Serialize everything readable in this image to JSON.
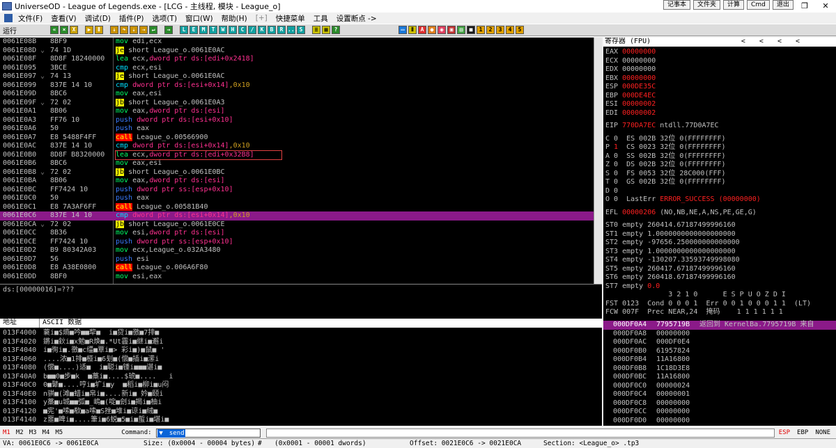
{
  "window": {
    "title": "UniverseOD - League of Legends.exe - [LCG - 主线程, 模块 - League_o]",
    "top_buttons": [
      "记事本",
      "文件夹",
      "计算",
      "Cmd",
      "退出"
    ]
  },
  "menu": [
    "文件(F)",
    "查看(V)",
    "调试(D)",
    "插件(P)",
    "选项(T)",
    "窗口(W)",
    "帮助(H)",
    "[+]",
    "快捷菜单",
    "工具",
    "设置断点 ->"
  ],
  "toolbar": {
    "status": "运行",
    "letters": [
      "L",
      "E",
      "M",
      "T",
      "W",
      "H",
      "C",
      "/",
      "K",
      "B",
      "R",
      "...",
      "S"
    ],
    "nums": [
      "1",
      "2",
      "3",
      "4",
      "5"
    ]
  },
  "colors": {
    "selection": "#8b1a89",
    "call_bg": "#ff0000",
    "jump_bg": "#ffff00"
  },
  "cpu": {
    "rows": [
      {
        "addr": "0061E08B",
        "tick": "",
        "hex": "8BF9",
        "m": "mov",
        "mc": "mov",
        "ops": [
          [
            "edi,ecx",
            "reg"
          ]
        ]
      },
      {
        "addr": "0061E08D",
        "tick": "⌄",
        "hex": "74 1D",
        "m": "je",
        "mc": "jmp",
        "ops": [
          [
            "short League_o.0061E0AC",
            "reg"
          ]
        ]
      },
      {
        "addr": "0061E08F",
        "tick": "",
        "hex": "8D8F 18240000",
        "m": "lea",
        "mc": "lea",
        "ops": [
          [
            "ecx,",
            "reg"
          ],
          [
            "dword ptr ds:[edi+0x2418]",
            "mem"
          ]
        ]
      },
      {
        "addr": "0061E095",
        "tick": "",
        "hex": "3BCE",
        "m": "cmp",
        "mc": "cmp",
        "ops": [
          [
            "ecx,esi",
            "reg"
          ]
        ]
      },
      {
        "addr": "0061E097",
        "tick": "⌄",
        "hex": "74 13",
        "m": "je",
        "mc": "jmp",
        "ops": [
          [
            "short League_o.0061E0AC",
            "reg"
          ]
        ]
      },
      {
        "addr": "0061E099",
        "tick": "",
        "hex": "837E 14 10",
        "m": "cmp",
        "mc": "cmp",
        "ops": [
          [
            "dword ptr ds:[esi+0x14]",
            "mem"
          ],
          [
            ",0x10",
            "imm"
          ]
        ]
      },
      {
        "addr": "0061E09D",
        "tick": "",
        "hex": "8BC6",
        "m": "mov",
        "mc": "mov",
        "ops": [
          [
            "eax,esi",
            "reg"
          ]
        ]
      },
      {
        "addr": "0061E09F",
        "tick": "⌄",
        "hex": "72 02",
        "m": "jb",
        "mc": "jmp",
        "ops": [
          [
            "short League_o.0061E0A3",
            "reg"
          ]
        ]
      },
      {
        "addr": "0061E0A1",
        "tick": "",
        "hex": "8B06",
        "m": "mov",
        "mc": "mov",
        "ops": [
          [
            "eax,",
            "reg"
          ],
          [
            "dword ptr ds:[esi]",
            "mem"
          ]
        ]
      },
      {
        "addr": "0061E0A3",
        "tick": "",
        "hex": "FF76 10",
        "m": "push",
        "mc": "push",
        "ops": [
          [
            "dword ptr ds:[esi+0x10]",
            "mem"
          ]
        ]
      },
      {
        "addr": "0061E0A6",
        "tick": "",
        "hex": "50",
        "m": "push",
        "mc": "push",
        "ops": [
          [
            "eax",
            "reg"
          ]
        ]
      },
      {
        "addr": "0061E0A7",
        "tick": "",
        "hex": "E8 5488F4FF",
        "m": "call",
        "mc": "call",
        "ops": [
          [
            "League_o.00566900",
            "reg"
          ]
        ]
      },
      {
        "addr": "0061E0AC",
        "tick": "",
        "hex": "837E 14 10",
        "m": "cmp",
        "mc": "cmp",
        "ops": [
          [
            "dword ptr ds:[esi+0x14]",
            "mem"
          ],
          [
            ",0x10",
            "imm"
          ]
        ]
      },
      {
        "addr": "0061E0B0",
        "tick": "",
        "hex": "8D8F B8320000",
        "m": "lea",
        "mc": "lea",
        "ops": [
          [
            "ecx,",
            "reg"
          ],
          [
            "dword ptr ds:[edi+0x32B8]",
            "mem"
          ]
        ],
        "box": true
      },
      {
        "addr": "0061E0B6",
        "tick": "",
        "hex": "8BC6",
        "m": "mov",
        "mc": "mov",
        "ops": [
          [
            "eax,esi",
            "reg"
          ]
        ]
      },
      {
        "addr": "0061E0B8",
        "tick": "⌄",
        "hex": "72 02",
        "m": "jb",
        "mc": "jmp",
        "ops": [
          [
            "short League_o.0061E0BC",
            "reg"
          ]
        ]
      },
      {
        "addr": "0061E0BA",
        "tick": "",
        "hex": "8B06",
        "m": "mov",
        "mc": "mov",
        "ops": [
          [
            "eax,",
            "reg"
          ],
          [
            "dword ptr ds:[esi]",
            "mem"
          ]
        ]
      },
      {
        "addr": "0061E0BC",
        "tick": "",
        "hex": "FF7424 10",
        "m": "push",
        "mc": "push",
        "ops": [
          [
            "dword ptr ss:[esp+0x10]",
            "mem"
          ]
        ]
      },
      {
        "addr": "0061E0C0",
        "tick": "",
        "hex": "50",
        "m": "push",
        "mc": "push",
        "ops": [
          [
            "eax",
            "reg"
          ]
        ]
      },
      {
        "addr": "0061E0C1",
        "tick": "",
        "hex": "E8 7A3AF6FF",
        "m": "call",
        "mc": "call",
        "ops": [
          [
            "League_o.00581B40",
            "reg"
          ]
        ]
      },
      {
        "addr": "0061E0C6",
        "tick": "",
        "hex": "837E 14 10",
        "m": "cmp",
        "mc": "cmp",
        "ops": [
          [
            "dword ptr ds:[esi+0x14]",
            "mem"
          ],
          [
            ",0x10",
            "imm"
          ]
        ],
        "sel": true
      },
      {
        "addr": "0061E0CA",
        "tick": "⌄",
        "hex": "72 02",
        "m": "jb",
        "mc": "jmp",
        "ops": [
          [
            "short League_o.0061E0CE",
            "reg"
          ]
        ]
      },
      {
        "addr": "0061E0CC",
        "tick": "",
        "hex": "8B36",
        "m": "mov",
        "mc": "mov",
        "ops": [
          [
            "esi,",
            "reg"
          ],
          [
            "dword ptr ds:[esi]",
            "mem"
          ]
        ]
      },
      {
        "addr": "0061E0CE",
        "tick": "",
        "hex": "FF7424 10",
        "m": "push",
        "mc": "push",
        "ops": [
          [
            "dword ptr ss:[esp+0x10]",
            "mem"
          ]
        ]
      },
      {
        "addr": "0061E0D2",
        "tick": "",
        "hex": "B9 80342A03",
        "m": "mov",
        "mc": "mov",
        "ops": [
          [
            "ecx,League_o.032A3480",
            "reg"
          ]
        ]
      },
      {
        "addr": "0061E0D7",
        "tick": "",
        "hex": "56",
        "m": "push",
        "mc": "push",
        "ops": [
          [
            "esi",
            "reg"
          ]
        ]
      },
      {
        "addr": "0061E0D8",
        "tick": "",
        "hex": "E8 A38E0800",
        "m": "call",
        "mc": "call",
        "ops": [
          [
            "League_o.006A6F80",
            "reg"
          ]
        ]
      },
      {
        "addr": "0061E0DD",
        "tick": "",
        "hex": "8BF0",
        "m": "mov",
        "mc": "mov",
        "ops": [
          [
            "esi,eax",
            "reg"
          ]
        ]
      }
    ]
  },
  "info": {
    "line": "ds:[00000016]=???"
  },
  "regs": {
    "title": "寄存器 (FPU)",
    "arrows": [
      "<",
      "<",
      "<",
      "<"
    ],
    "lines": [
      {
        "t": "EAX ",
        "v": "00000000",
        "red": true,
        "rest": ""
      },
      {
        "t": "ECX ",
        "v": "00000000",
        "red": false,
        "rest": ""
      },
      {
        "t": "EDX ",
        "v": "00000000",
        "red": false,
        "rest": ""
      },
      {
        "t": "EBX ",
        "v": "00000000",
        "red": true,
        "rest": ""
      },
      {
        "t": "ESP ",
        "v": "000DE35C",
        "red": true,
        "rest": ""
      },
      {
        "t": "EBP ",
        "v": "000DE4EC",
        "red": true,
        "rest": ""
      },
      {
        "t": "ESI ",
        "v": "00000002",
        "red": true,
        "rest": ""
      },
      {
        "t": "EDI ",
        "v": "00000002",
        "red": true,
        "rest": ""
      },
      {
        "gap": true
      },
      {
        "t": "EIP ",
        "v": "770DA7EC",
        "red": true,
        "rest": " ntdll.77D0A7EC"
      },
      {
        "gap": true
      },
      {
        "t": "C 0  ",
        "v": "",
        "red": false,
        "rest": "ES 002B 32位 0(FFFFFFFF)"
      },
      {
        "t": "P ",
        "v": "1",
        "red": true,
        "rest": "  CS 0023 32位 0(FFFFFFFF)"
      },
      {
        "t": "A 0  ",
        "v": "",
        "red": false,
        "rest": "SS 002B 32位 0(FFFFFFFF)"
      },
      {
        "t": "Z 0  ",
        "v": "",
        "red": false,
        "rest": "DS 002B 32位 0(FFFFFFFF)"
      },
      {
        "t": "S 0  ",
        "v": "",
        "red": false,
        "rest": "FS 0053 32位 28C000(FFF)"
      },
      {
        "t": "T 0  ",
        "v": "",
        "red": false,
        "rest": "GS 002B 32位 0(FFFFFFFF)"
      },
      {
        "t": "D 0",
        "v": "",
        "red": false,
        "rest": ""
      },
      {
        "t": "O 0  LastErr ",
        "v": "ERROR_SUCCESS (00000000)",
        "red": true,
        "rest": ""
      },
      {
        "gap": true
      },
      {
        "t": "EFL ",
        "v": "00000206",
        "red": true,
        "rest": " (NO,NB,NE,A,NS,PE,GE,G)"
      },
      {
        "gap": true
      },
      {
        "t": "ST0 empty 260414.67187499996160",
        "v": "",
        "red": false,
        "rest": ""
      },
      {
        "t": "ST1 empty 1.0000000000000000000",
        "v": "",
        "red": false,
        "rest": ""
      },
      {
        "t": "ST2 empty -97656.250000000000000",
        "v": "",
        "red": false,
        "rest": ""
      },
      {
        "t": "ST3 empty 1.0000000000000000000",
        "v": "",
        "red": false,
        "rest": ""
      },
      {
        "t": "ST4 empty -130207.33593749998080",
        "v": "",
        "red": false,
        "rest": ""
      },
      {
        "t": "ST5 empty 260417.67187499996160",
        "v": "",
        "red": false,
        "rest": ""
      },
      {
        "t": "ST6 empty 260418.67187499996160",
        "v": "",
        "red": false,
        "rest": ""
      },
      {
        "t": "ST7 empty ",
        "v": "0.0",
        "red": true,
        "rest": ""
      },
      {
        "t": "               3 2 1 0      E S P U O Z D I",
        "v": "",
        "red": false,
        "rest": ""
      },
      {
        "t": "FST 0123  Cond 0 0 0 1  Err 0 0 1 0 0 0 1 1  (LT)",
        "v": "",
        "red": false,
        "rest": ""
      },
      {
        "t": "FCW 007F  Prec NEAR,24  掩码    1 1 1 1 1 1",
        "v": "",
        "red": false,
        "rest": ""
      }
    ]
  },
  "dump": {
    "col_addr": "地址",
    "col_ascii": "ASCII 数据",
    "rows": [
      {
        "addr": "013F4000",
        "ascii": "蓑i■$熵■吟■■犂■  i■贷i■徼■7排■"
      },
      {
        "addr": "013F4020",
        "ascii": "鏘i■鈥i■x勉■R焕■.*Ut霾i■继i■邂i"
      },
      {
        "addr": "013F4040",
        "ascii": "i■徇i■.徼■c缰■覃i■> 彩i■)■鼠■ '"
      },
      {
        "addr": "013F4060",
        "ascii": "....浓■1排■桠i■6刬■(偿■插i■潆i"
      },
      {
        "addr": "013F4080",
        "ascii": "(偿■....)适■  i■聪i■锺i■■■谌i■"
      },
      {
        "addr": "013F40A0",
        "ascii": "b■■0■步■k  ■藁i■....$琥■....   i"
      },
      {
        "addr": "013F40C0",
        "ascii": "0■鼙■....哼i■圹i■y  ■稻i■柳i■u闷"
      },
      {
        "addr": "013F40E0",
        "ascii": "n骐■(滩■蜡i■帛i■....新i■ 妗■颐i"
      },
      {
        "addr": "013F4100",
        "ascii": "y藁■u城■■弧■_嶋■(啶■刽i■揭i■柚i"
      },
      {
        "addr": "013F4120",
        "ascii": "■宪'■嗦■欷■a嗦■S挫■堆i■谅i■绒■"
      },
      {
        "addr": "013F4140",
        "ascii": "z噩■睥i■....筆i■6蜕■5■i■蜇i■堪i■"
      }
    ]
  },
  "stack": {
    "rows": [
      {
        "addr": "000DF0A4",
        "val": "7795719B",
        "com": "返回到 KernelBa.7795719B 来自",
        "sel": true
      },
      {
        "addr": "000DF0A8",
        "val": "00000000",
        "com": ""
      },
      {
        "addr": "000DF0AC",
        "val": "000DF0E4",
        "com": ""
      },
      {
        "addr": "000DF0B0",
        "val": "61957824",
        "com": ""
      },
      {
        "addr": "000DF0B4",
        "val": "11A16800",
        "com": ""
      },
      {
        "addr": "000DF0B8",
        "val": "1C18D3E8",
        "com": ""
      },
      {
        "addr": "000DF0BC",
        "val": "11A16800",
        "com": ""
      },
      {
        "addr": "000DF0C0",
        "val": "00000024",
        "com": ""
      },
      {
        "addr": "000DF0C4",
        "val": "00000001",
        "com": ""
      },
      {
        "addr": "000DF0C8",
        "val": "00000000",
        "com": ""
      },
      {
        "addr": "000DF0CC",
        "val": "00000000",
        "com": ""
      },
      {
        "addr": "000DF0D0",
        "val": "00000000",
        "com": ""
      }
    ]
  },
  "cmdbar": {
    "tabs": [
      "M1",
      "M2",
      "M3",
      "M4",
      "M5"
    ],
    "label": "Command:",
    "value": "bp send",
    "right": [
      "ESP",
      "EBP",
      "NONE"
    ]
  },
  "statusbar": {
    "va": "VA: 0061E0C6 -> 0061E0CA",
    "size": "Size: (0x0004 - 00004 bytes)",
    "hash": "#",
    "dwords": "(0x0001 - 00001 dwords)",
    "offset": "Offset: 0021E0C6 -> 0021E0CA",
    "section": "Section: <League_o> .tp3"
  }
}
